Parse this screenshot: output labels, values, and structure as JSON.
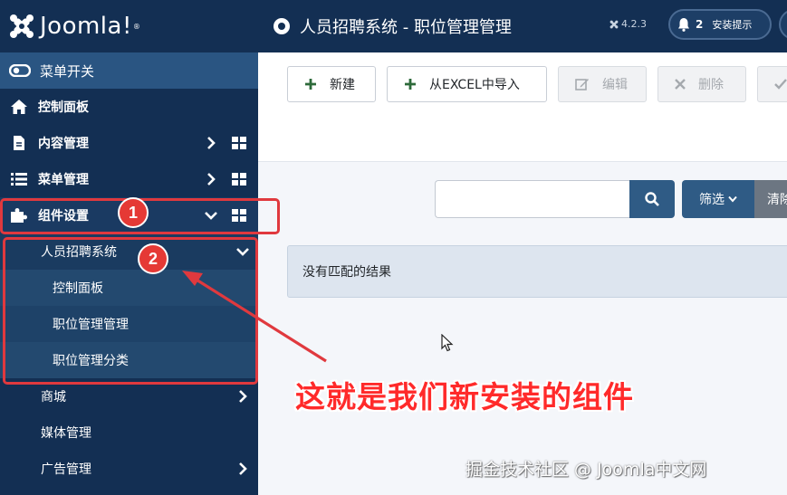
{
  "brand": {
    "name": "Joomla!",
    "reg": "®"
  },
  "sidebar": {
    "toggle_label": "菜单开关",
    "items": [
      {
        "label": "控制面板"
      },
      {
        "label": "内容管理"
      },
      {
        "label": "菜单管理"
      },
      {
        "label": "组件设置"
      }
    ],
    "component": {
      "label": "人员招聘系统",
      "children": [
        {
          "label": "控制面板"
        },
        {
          "label": "职位管理管理"
        },
        {
          "label": "职位管理分类"
        }
      ]
    },
    "more": [
      {
        "label": "商城"
      },
      {
        "label": "媒体管理"
      },
      {
        "label": "广告管理"
      }
    ]
  },
  "header": {
    "title": "人员招聘系统 - 职位管理管理",
    "version": "4.2.3",
    "notif_count": "2",
    "notif_label": "安装提示"
  },
  "toolbar": {
    "new": "新建",
    "import": "从EXCEL中导入",
    "edit": "编辑",
    "delete": "删除"
  },
  "filters": {
    "search_value": "",
    "filter_label": "筛选",
    "clear_label": "清除"
  },
  "results": {
    "empty_message": "没有匹配的结果"
  },
  "annotations": {
    "badge1": "1",
    "badge2": "2",
    "callout": "这就是我们新安装的组件"
  },
  "watermark": "掘金技术社区 @ Joomla中文网",
  "colors": {
    "sidebar_bg": "#132f53",
    "primary_button": "#2f5b85",
    "annotation_red": "#e0393e"
  }
}
